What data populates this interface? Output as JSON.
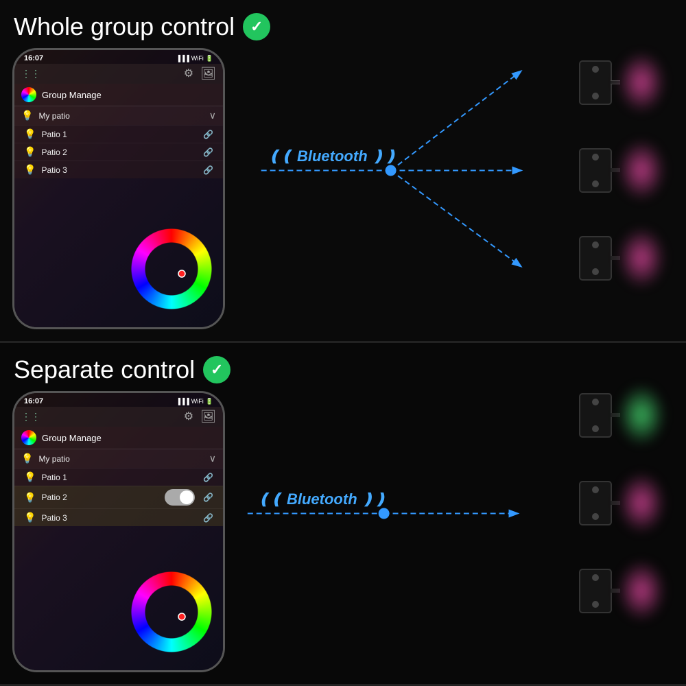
{
  "top_panel": {
    "title": "Whole group control",
    "check": "✓",
    "phone": {
      "time": "16:07",
      "group_label": "Group Manage",
      "my_patio": "My patio",
      "patio_items": [
        {
          "label": "Patio 1",
          "highlighted": false
        },
        {
          "label": "Patio 2",
          "highlighted": false
        },
        {
          "label": "Patio 3",
          "highlighted": false
        }
      ]
    },
    "bluetooth_label": "Bluetooth",
    "devices": [
      {
        "glow": "pink"
      },
      {
        "glow": "pink"
      },
      {
        "glow": "pink"
      }
    ]
  },
  "bottom_panel": {
    "title": "Separate control",
    "check": "✓",
    "phone": {
      "time": "16:07",
      "group_label": "Group Manage",
      "my_patio": "My patio",
      "patio_items": [
        {
          "label": "Patio 1",
          "highlighted": false
        },
        {
          "label": "Patio 2",
          "highlighted": true
        },
        {
          "label": "Patio 3",
          "highlighted": true
        }
      ]
    },
    "bluetooth_label": "Bluetooth",
    "devices": [
      {
        "glow": "green"
      },
      {
        "glow": "pink"
      },
      {
        "glow": "pink"
      }
    ]
  }
}
